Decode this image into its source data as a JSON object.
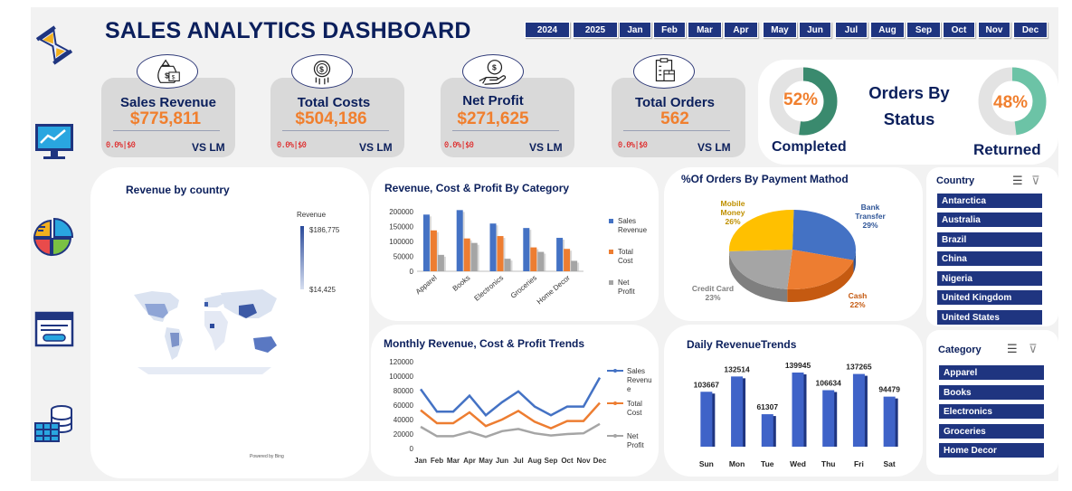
{
  "header": {
    "title": "SALES ANALYTICS DASHBOARD"
  },
  "years": [
    "2024",
    "2025"
  ],
  "months": [
    "Jan",
    "Feb",
    "Mar",
    "Apr",
    "May",
    "Jun",
    "Jul",
    "Aug",
    "Sep",
    "Oct",
    "Nov",
    "Dec"
  ],
  "kpis": [
    {
      "label": "Sales Revenue",
      "value": "$775,811",
      "delta": "0.0%|$0",
      "vs": "VS LM",
      "icon": "money-bag-icon"
    },
    {
      "label": "Total Costs",
      "value": "$504,186",
      "delta": "0.0%|$0",
      "vs": "VS LM",
      "icon": "coin-cost-icon"
    },
    {
      "label": "Net Profit",
      "value": "$271,625",
      "delta": "0.0%|$0",
      "vs": "VS LM",
      "icon": "hand-dollar-icon"
    },
    {
      "label": "Total Orders",
      "value": "562",
      "delta": "0.0%|$0",
      "vs": "VS LM",
      "icon": "clipboard-box-icon"
    }
  ],
  "orders_status": {
    "title_line1": "Orders By",
    "title_line2": "Status",
    "completed_pct": "52%",
    "completed_label": "Completed",
    "completed_value": 0.52,
    "returned_pct": "48%",
    "returned_label": "Returned",
    "returned_value": 0.48
  },
  "map_panel": {
    "title": "Revenue by country",
    "legend_title": "Revenue",
    "legend_max": "$186,775",
    "legend_min": "$14,425",
    "credit": "Powered by Bing"
  },
  "sidebar": {
    "icons": [
      "hourglass-icon",
      "monitor-chart-icon",
      "pie-chart-icon",
      "window-card-icon",
      "database-table-icon"
    ]
  },
  "country_slicer": {
    "title": "Country",
    "items": [
      "Antarctica",
      "Australia",
      "Brazil",
      "China",
      "Nigeria",
      "United Kingdom",
      "United States"
    ]
  },
  "category_slicer": {
    "title": "Category",
    "items": [
      "Apparel",
      "Books",
      "Electronics",
      "Groceries",
      "Home Decor"
    ]
  },
  "colors": {
    "navy": "#1f3580",
    "blue": "#4472c4",
    "orange": "#ed7d31",
    "gray": "#a5a5a5",
    "green": "#3a8a6e",
    "kpi_value": "#f07f2e"
  },
  "chart_data": [
    {
      "type": "bar",
      "title": "Revenue, Cost & Profit By Category",
      "categories": [
        "Apparel",
        "Books",
        "Electronics",
        "Groceries",
        "Home Decor"
      ],
      "ylim": [
        0,
        200000
      ],
      "yticks": [
        "0",
        "50000",
        "100000",
        "150000",
        "200000"
      ],
      "series": [
        {
          "name": "Sales Revenue",
          "legend_lines": [
            "Sales",
            "Revenue"
          ],
          "values": [
            190000,
            205000,
            160000,
            145000,
            112000
          ]
        },
        {
          "name": "Total Cost",
          "legend_lines": [
            "Total",
            "Cost"
          ],
          "values": [
            137000,
            110000,
            118000,
            80000,
            75000
          ]
        },
        {
          "name": "Net Profit",
          "legend_lines": [
            "Net",
            "Profit"
          ],
          "values": [
            55000,
            95000,
            42000,
            65000,
            35000
          ]
        }
      ]
    },
    {
      "type": "pie",
      "title": "%Of Orders By Payment Mathod",
      "slices": [
        {
          "name_lines": [
            "Bank",
            "Transfer"
          ],
          "pct_label": "29%",
          "value": 29
        },
        {
          "name_lines": [
            "Cash"
          ],
          "pct_label": "22%",
          "value": 22
        },
        {
          "name_lines": [
            "Credit Card"
          ],
          "pct_label": "23%",
          "value": 23
        },
        {
          "name_lines": [
            "Mobile",
            "Money"
          ],
          "pct_label": "26%",
          "value": 26
        }
      ]
    },
    {
      "type": "line",
      "title": "Monthly Revenue, Cost & Profit Trends",
      "categories": [
        "Jan",
        "Feb",
        "Mar",
        "Apr",
        "May",
        "Jun",
        "Jul",
        "Aug",
        "Sep",
        "Oct",
        "Nov",
        "Dec"
      ],
      "ylim": [
        0,
        120000
      ],
      "yticks": [
        "0",
        "20000",
        "40000",
        "60000",
        "80000",
        "100000",
        "120000"
      ],
      "series": [
        {
          "name": "Sales Revenue",
          "legend_lines": [
            "Sales",
            "Revenu",
            "e"
          ],
          "values": [
            82000,
            51000,
            51000,
            73000,
            46000,
            64000,
            79000,
            58000,
            46000,
            58000,
            58000,
            98000
          ]
        },
        {
          "name": "Total Cost",
          "legend_lines": [
            "Total",
            "Cost"
          ],
          "values": [
            53000,
            35000,
            35000,
            50000,
            31000,
            40000,
            52000,
            37000,
            28000,
            38000,
            38000,
            63000
          ]
        },
        {
          "name": "Net Profit",
          "legend_lines": [
            "Net",
            "Profit"
          ],
          "values": [
            30000,
            17000,
            17000,
            23000,
            16000,
            24000,
            27000,
            21000,
            18000,
            20000,
            21000,
            34000
          ]
        }
      ]
    },
    {
      "type": "bar",
      "title": "Daily RevenueTrends",
      "categories": [
        "Sun",
        "Mon",
        "Tue",
        "Wed",
        "Thu",
        "Fri",
        "Sat"
      ],
      "values": [
        103667,
        132514,
        61307,
        139945,
        106634,
        137265,
        94479
      ],
      "labels": [
        "103667",
        "132514",
        "61307",
        "139945",
        "106634",
        "137265",
        "94479"
      ]
    }
  ]
}
